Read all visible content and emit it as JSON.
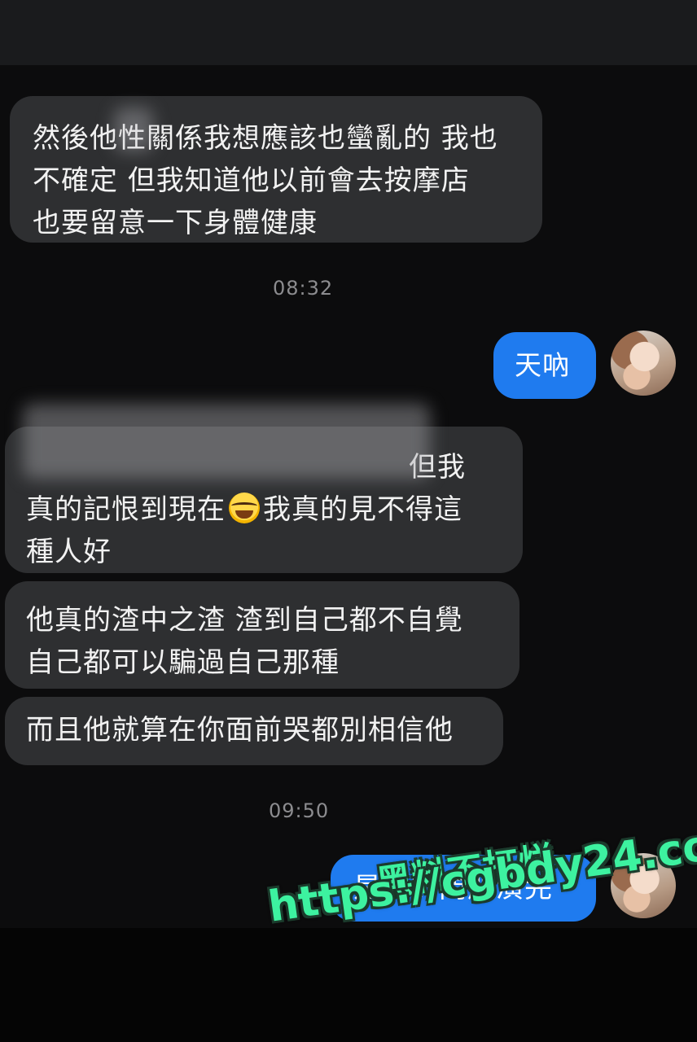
{
  "messages": {
    "m1": {
      "lines": [
        "然後他性關係我想應該也蠻亂的 我也",
        "不確定 但我知道他以前會去按摩店",
        "也要留意一下身體健康"
      ]
    },
    "ts1": "08:32",
    "m2": {
      "text": "天吶"
    },
    "m3": {
      "line1_end": "但我",
      "line2_a": "真的記恨到現在",
      "line2_b": "我真的見不得這",
      "line3": "種人好"
    },
    "m4": {
      "lines": [
        "他真的渣中之渣 渣到自己都不自覺",
        "自己都可以騙過自己那種"
      ]
    },
    "m5": {
      "text": "而且他就算在你面前哭都別相信他"
    },
    "ts2": "09:50",
    "m6": {
      "text": "是他的問題演完"
    }
  },
  "watermark": {
    "line1": "黑料不打烊",
    "line2": "https://cgbdy24.com"
  },
  "colors": {
    "incoming_bubble": "#2e2f31",
    "outgoing_bubble": "#1f7bef",
    "watermark": "#3df2a0"
  }
}
